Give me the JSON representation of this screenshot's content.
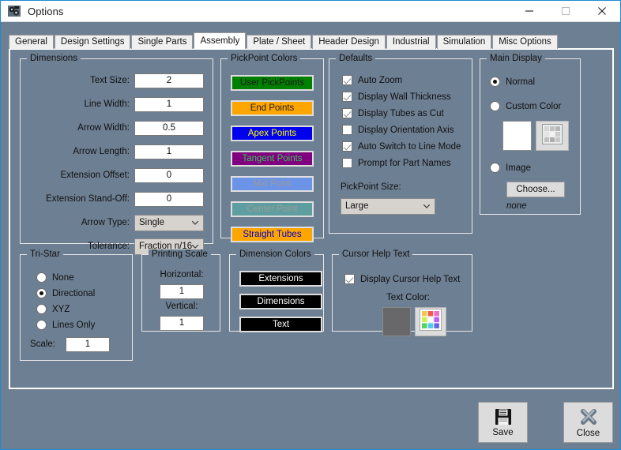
{
  "window": {
    "title": "Options",
    "icon": "options-gear-icon",
    "minimize_label": "—",
    "maximize_label": "□",
    "close_label": "✕"
  },
  "tabs": [
    {
      "label": "General",
      "active": false
    },
    {
      "label": "Design Settings",
      "active": false
    },
    {
      "label": "Single Parts",
      "active": false
    },
    {
      "label": "Assembly",
      "active": true
    },
    {
      "label": "Plate / Sheet",
      "active": false
    },
    {
      "label": "Header Design",
      "active": false
    },
    {
      "label": "Industrial",
      "active": false
    },
    {
      "label": "Simulation",
      "active": false
    },
    {
      "label": "Misc Options",
      "active": false
    }
  ],
  "dimensions": {
    "legend": "Dimensions",
    "fields": [
      {
        "label": "Text Size:",
        "value": "2"
      },
      {
        "label": "Line Width:",
        "value": "1"
      },
      {
        "label": "Arrow Width:",
        "value": "0.5"
      },
      {
        "label": "Arrow Length:",
        "value": "1"
      },
      {
        "label": "Extension Offset:",
        "value": "0"
      },
      {
        "label": "Extension Stand-Off:",
        "value": "0"
      }
    ],
    "arrow_type": {
      "label": "Arrow Type:",
      "value": "Single"
    },
    "tolerance": {
      "label": "Tolerance:",
      "value": "Fraction n/16"
    }
  },
  "pickpoint_colors": {
    "legend": "PickPoint Colors",
    "buttons": [
      {
        "label": "User PickPoints",
        "bg": "#008000",
        "fg": "#1a1a1a"
      },
      {
        "label": "End Points",
        "bg": "#ffa500",
        "fg": "#1a1a1a"
      },
      {
        "label": "Apex Points",
        "bg": "#0000ee",
        "fg": "#ffff00"
      },
      {
        "label": "Tangent Points",
        "bg": "#800080",
        "fg": "#33cc55"
      },
      {
        "label": "Mid Point",
        "bg": "#6b93e8",
        "fg": "#9a9a9a"
      },
      {
        "label": "Center Point",
        "bg": "#5f9ea0",
        "fg": "#9a9a9a"
      },
      {
        "label": "Straight Tubes",
        "bg": "#ffa500",
        "fg": "#0000cd"
      }
    ]
  },
  "defaults": {
    "legend": "Defaults",
    "checkboxes": [
      {
        "label": "Auto Zoom",
        "checked": true
      },
      {
        "label": "Display Wall Thickness",
        "checked": true
      },
      {
        "label": "Display Tubes as Cut",
        "checked": true
      },
      {
        "label": "Display Orientation Axis",
        "checked": false
      },
      {
        "label": "Auto Switch to Line Mode",
        "checked": true
      },
      {
        "label": "Prompt for Part Names",
        "checked": false
      }
    ],
    "pickpoint_size": {
      "label": "PickPoint Size:",
      "value": "Large"
    }
  },
  "main_display": {
    "legend": "Main Display",
    "radios": [
      {
        "label": "Normal",
        "selected": true
      },
      {
        "label": "Custom Color",
        "selected": false
      },
      {
        "label": "Image",
        "selected": false
      }
    ],
    "custom_color_swatch": "#ffffff",
    "palette_icon": "color-palette-icon-disabled",
    "choose_label": "Choose...",
    "image_value": "none"
  },
  "tri_star": {
    "legend": "Tri-Star",
    "radios": [
      {
        "label": "None",
        "selected": false
      },
      {
        "label": "Directional",
        "selected": true
      },
      {
        "label": "XYZ",
        "selected": false
      },
      {
        "label": "Lines Only",
        "selected": false
      }
    ],
    "scale": {
      "label": "Scale:",
      "value": "1"
    }
  },
  "printing_scale": {
    "legend": "Printing Scale",
    "horizontal": {
      "label": "Horizontal:",
      "value": "1"
    },
    "vertical": {
      "label": "Vertical:",
      "value": "1"
    }
  },
  "dimension_colors": {
    "legend": "Dimension Colors",
    "buttons": [
      {
        "label": "Extensions",
        "bg": "#000000",
        "fg": "#ffffff"
      },
      {
        "label": "Dimensions",
        "bg": "#000000",
        "fg": "#ffffff"
      },
      {
        "label": "Text",
        "bg": "#000000",
        "fg": "#ffffff"
      }
    ]
  },
  "cursor_help_text": {
    "legend": "Cursor Help Text",
    "checkbox": {
      "label": "Display Cursor Help Text",
      "checked": true
    },
    "text_color_label": "Text Color:",
    "text_color_swatch": "#68686a",
    "palette_icon": "color-palette-icon",
    "palette_colors": [
      "#f0c850",
      "#f05a50",
      "#f06ac8",
      "#c8f050",
      "#ffffff",
      "#b464f0",
      "#50d264",
      "#50c8f0",
      "#6464e6"
    ]
  },
  "footer": {
    "save_label": "Save",
    "save_icon": "floppy-disk-icon",
    "close_label": "Close",
    "close_icon": "x-mark-icon"
  }
}
